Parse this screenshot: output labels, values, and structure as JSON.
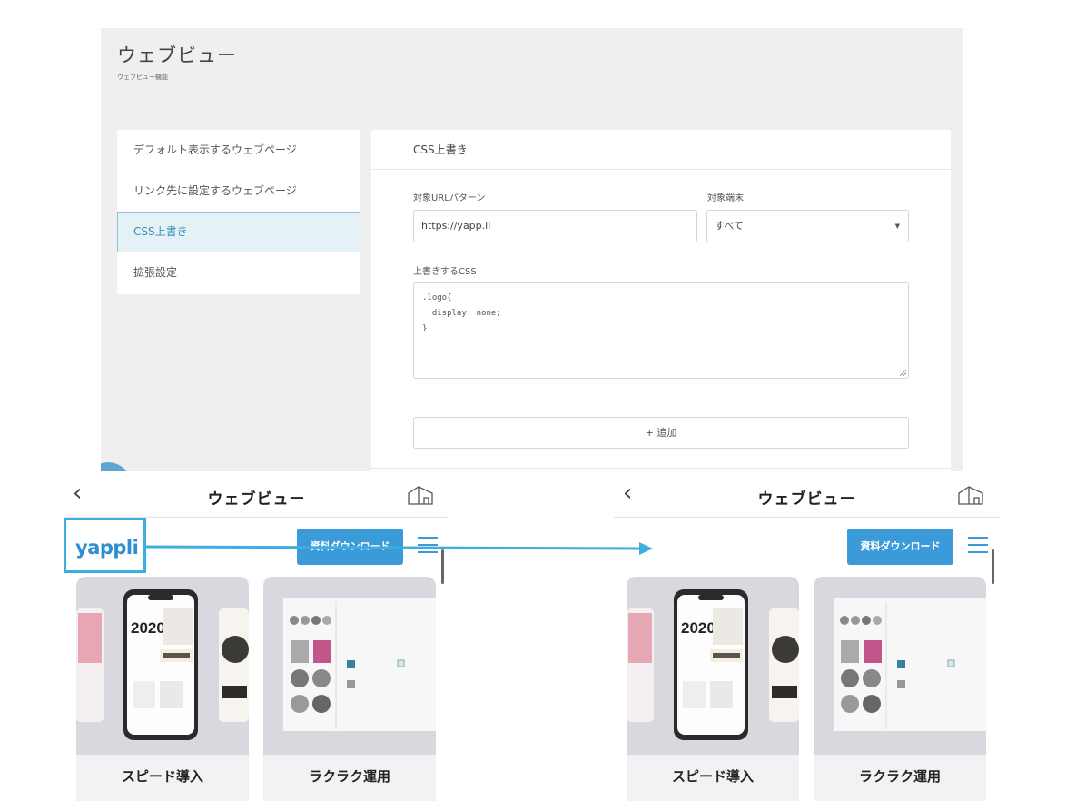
{
  "admin": {
    "title": "ウェブビュー",
    "subtitle": "ウェブビュー機能",
    "sidenav": [
      {
        "label": "デフォルト表示するウェブページ",
        "active": false
      },
      {
        "label": "リンク先に設定するウェブページ",
        "active": false
      },
      {
        "label": "CSS上書き",
        "active": true
      },
      {
        "label": "拡張設定",
        "active": false
      }
    ],
    "card": {
      "header": "CSS上書き",
      "url_label": "対象URLパターン",
      "url_value": "https://yapp.li",
      "device_label": "対象端末",
      "device_value": "すべて",
      "css_label": "上書きするCSS",
      "css_lines": [
        ".logo{",
        "  display: none;",
        "}"
      ],
      "add_button": "+ 追加"
    }
  },
  "phones": [
    {
      "nav_title": "ウェブビュー",
      "logo_text": "yappli",
      "download_button": "資料ダウンロード",
      "tiles": [
        {
          "caption": "スピード導入",
          "hero": "2020"
        },
        {
          "caption": "ラクラク運用"
        }
      ]
    },
    {
      "nav_title": "ウェブビュー",
      "download_button": "資料ダウンロード",
      "tiles": [
        {
          "caption": "スピード導入",
          "hero": "2020"
        },
        {
          "caption": "ラクラク運用"
        }
      ]
    }
  ],
  "colors": {
    "accent": "#3a9bd8",
    "highlight": "#3daee0",
    "active_bg": "#e4f1f7",
    "panel_bg": "#efefef"
  },
  "icons": [
    "chevron-left-icon",
    "home-icon",
    "hamburger-menu-icon",
    "arrow-right-icon",
    "dropdown-caret-icon"
  ]
}
